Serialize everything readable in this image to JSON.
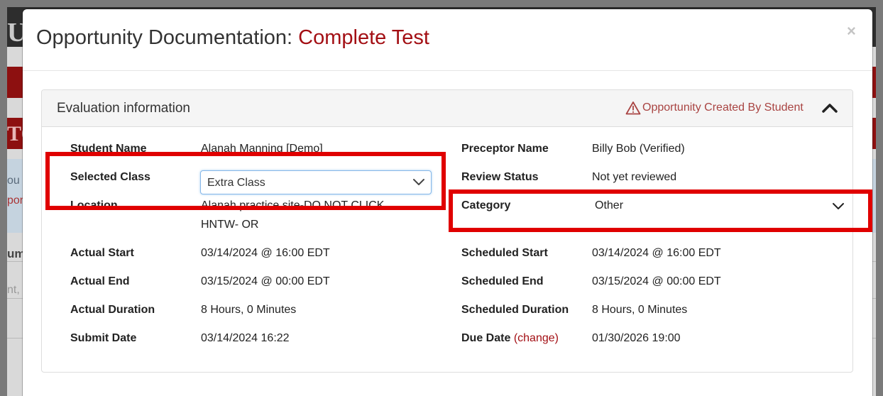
{
  "background": {
    "logo_fragment": "U",
    "header_fragment": "TO",
    "text_fragment_1": "ou",
    "text_fragment_2": "port",
    "text_fragment_3": "um",
    "text_fragment_4": "nt,"
  },
  "modal": {
    "title_prefix": "Opportunity Documentation: ",
    "title_accent": "Complete Test",
    "close_label": "×"
  },
  "panel": {
    "title": "Evaluation information",
    "created_by": "Opportunity Created By Student"
  },
  "left": {
    "student_name_label": "Student Name",
    "student_name_value": "Alanah Manning [Demo]",
    "selected_class_label": "Selected Class",
    "selected_class_value": "Extra Class",
    "location_label": "Location",
    "location_value_line1": "Alanah practice site-DO NOT CLICK",
    "location_value_line2": "HNTW- OR",
    "actual_start_label": "Actual Start",
    "actual_start_value": "03/14/2024 @ 16:00 EDT",
    "actual_end_label": "Actual End",
    "actual_end_value": "03/15/2024 @ 00:00 EDT",
    "actual_duration_label": "Actual Duration",
    "actual_duration_value": "8 Hours, 0 Minutes",
    "submit_date_label": "Submit Date",
    "submit_date_value": "03/14/2024 16:22"
  },
  "right": {
    "preceptor_name_label": "Preceptor Name",
    "preceptor_name_value": "Billy Bob (Verified)",
    "review_status_label": "Review Status",
    "review_status_value": "Not yet reviewed",
    "category_label": "Category",
    "category_value": "Other",
    "scheduled_start_label": "Scheduled Start",
    "scheduled_start_value": "03/14/2024 @ 16:00 EDT",
    "scheduled_end_label": "Scheduled End",
    "scheduled_end_value": "03/15/2024 @ 00:00 EDT",
    "scheduled_duration_label": "Scheduled Duration",
    "scheduled_duration_value": "8 Hours, 0 Minutes",
    "due_date_label": "Due Date",
    "due_date_change_link": "(change)",
    "due_date_value": "01/30/2026 19:00"
  },
  "colors": {
    "accent": "#a30f14",
    "warning": "#a94442",
    "annotation": "#e00000"
  },
  "icons": {
    "close": "close-icon",
    "warning": "warning-triangle-icon",
    "collapse": "chevron-up-icon",
    "dropdown": "chevron-down-icon"
  }
}
